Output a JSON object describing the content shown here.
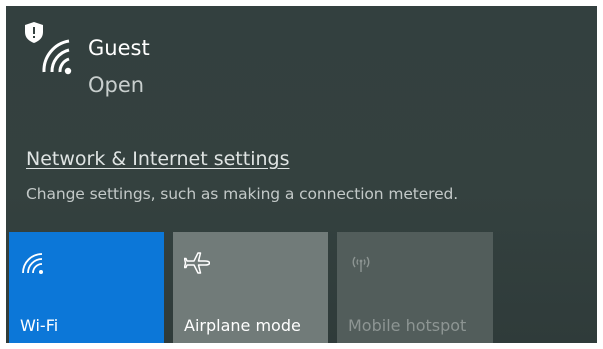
{
  "network": {
    "name": "Guest",
    "status": "Open",
    "icon": "wifi-shield-warning-icon"
  },
  "settings": {
    "link_label": "Network & Internet settings",
    "description": "Change settings, such as making a connection metered."
  },
  "quick_actions": [
    {
      "label": "Wi-Fi",
      "icon": "wifi-icon",
      "state": "on",
      "color": "#0c77d8"
    },
    {
      "label": "Airplane mode",
      "icon": "airplane-icon",
      "state": "off",
      "color": "#717b79"
    },
    {
      "label": "Mobile hotspot",
      "icon": "hotspot-icon",
      "state": "disabled",
      "color": "#525d5b"
    }
  ],
  "colors": {
    "background": "#33403f",
    "accent": "#0c77d8",
    "text": "#ffffff"
  }
}
